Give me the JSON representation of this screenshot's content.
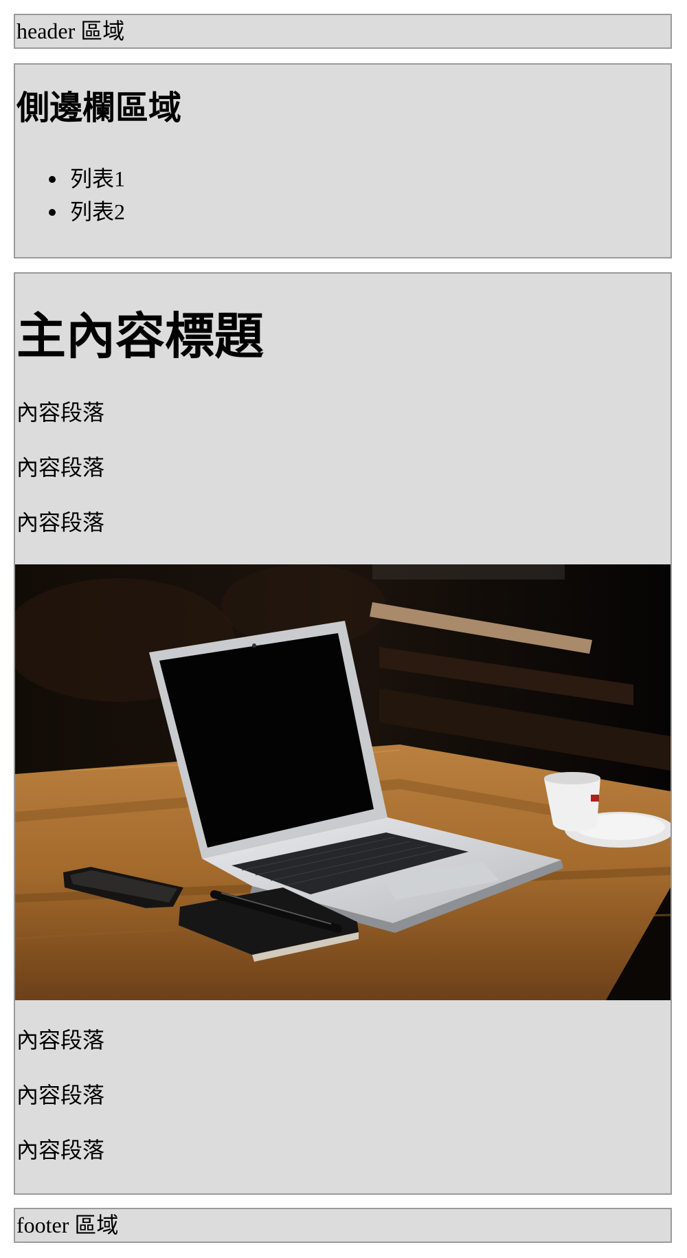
{
  "header": {
    "label": "header 區域"
  },
  "sidebar": {
    "title": "側邊欄區域",
    "items": [
      {
        "label": "列表1"
      },
      {
        "label": "列表2"
      }
    ]
  },
  "main": {
    "title": "主內容標題",
    "paragraphs_before": [
      "內容段落",
      "內容段落",
      "內容段落"
    ],
    "image": {
      "alt": "MacBook Air"
    },
    "paragraphs_after": [
      "內容段落",
      "內容段落",
      "內容段落"
    ]
  },
  "footer": {
    "label": "footer 區域"
  }
}
